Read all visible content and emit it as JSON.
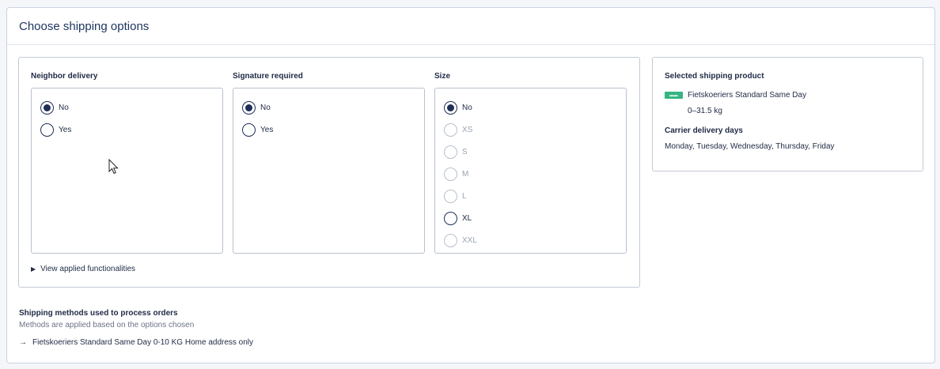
{
  "header": {
    "title": "Choose shipping options"
  },
  "groups": {
    "neighbor": {
      "label": "Neighbor delivery",
      "options": [
        {
          "label": "No",
          "checked": true,
          "disabled": false
        },
        {
          "label": "Yes",
          "checked": false,
          "disabled": false
        }
      ]
    },
    "signature": {
      "label": "Signature required",
      "options": [
        {
          "label": "No",
          "checked": true,
          "disabled": false
        },
        {
          "label": "Yes",
          "checked": false,
          "disabled": false
        }
      ]
    },
    "size": {
      "label": "Size",
      "options": [
        {
          "label": "No",
          "checked": true,
          "disabled": false
        },
        {
          "label": "XS",
          "checked": false,
          "disabled": true
        },
        {
          "label": "S",
          "checked": false,
          "disabled": true
        },
        {
          "label": "M",
          "checked": false,
          "disabled": true
        },
        {
          "label": "L",
          "checked": false,
          "disabled": true
        },
        {
          "label": "XL",
          "checked": false,
          "disabled": false
        },
        {
          "label": "XXL",
          "checked": false,
          "disabled": true
        }
      ]
    }
  },
  "view_applied": {
    "label": "View applied functionalities",
    "icon": "triangle-right-icon"
  },
  "selected_product": {
    "title": "Selected shipping product",
    "logo_color": "#36b583",
    "name": "Fietskoeriers Standard Same Day",
    "weight": "0–31.5 kg",
    "delivery_days_title": "Carrier delivery days",
    "delivery_days": "Monday, Tuesday, Wednesday, Thursday, Friday"
  },
  "methods": {
    "title": "Shipping methods used to process orders",
    "subtitle": "Methods are applied based on the options chosen",
    "items": [
      {
        "label": "Fietskoeriers Standard Same Day 0-10 KG Home address only",
        "icon": "arrow-right-icon"
      }
    ]
  },
  "colors": {
    "accent": "#1f2f57",
    "border": "#c3cad6",
    "disabled": "#b8bfcc"
  }
}
